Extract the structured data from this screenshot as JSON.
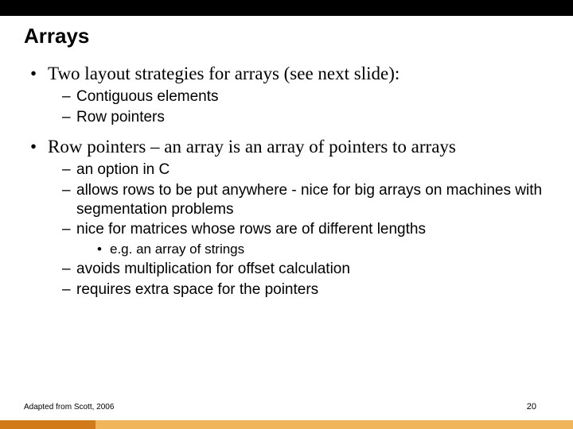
{
  "title": "Arrays",
  "bullets": [
    {
      "text": "Two layout strategies for arrays (see next slide):",
      "sub": [
        {
          "text": "Contiguous elements"
        },
        {
          "text": "Row pointers"
        }
      ]
    },
    {
      "text": "Row pointers – an array is an array of pointers to arrays",
      "sub": [
        {
          "text": "an option in C"
        },
        {
          "text": "allows rows to be put anywhere - nice for big arrays on machines with segmentation problems"
        },
        {
          "text": "nice for matrices whose rows are of different lengths",
          "sub3": [
            {
              "text": "e.g. an array of strings"
            }
          ]
        },
        {
          "text": "avoids multiplication for offset calculation"
        },
        {
          "text": "requires extra space for the pointers"
        }
      ]
    }
  ],
  "footer_left": "Adapted from Scott, 2006",
  "page_number": "20"
}
